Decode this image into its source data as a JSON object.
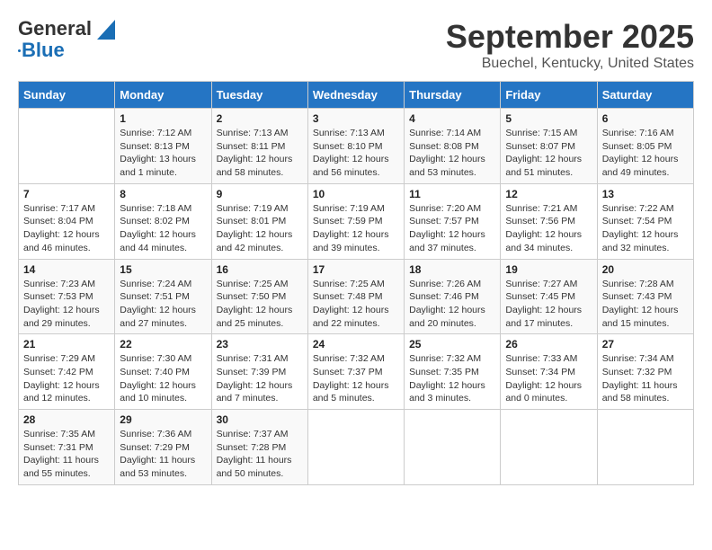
{
  "header": {
    "logo_general": "General",
    "logo_blue": "Blue",
    "title": "September 2025",
    "subtitle": "Buechel, Kentucky, United States"
  },
  "calendar": {
    "days_of_week": [
      "Sunday",
      "Monday",
      "Tuesday",
      "Wednesday",
      "Thursday",
      "Friday",
      "Saturday"
    ],
    "weeks": [
      [
        {
          "day": "",
          "info": ""
        },
        {
          "day": "1",
          "info": "Sunrise: 7:12 AM\nSunset: 8:13 PM\nDaylight: 13 hours\nand 1 minute."
        },
        {
          "day": "2",
          "info": "Sunrise: 7:13 AM\nSunset: 8:11 PM\nDaylight: 12 hours\nand 58 minutes."
        },
        {
          "day": "3",
          "info": "Sunrise: 7:13 AM\nSunset: 8:10 PM\nDaylight: 12 hours\nand 56 minutes."
        },
        {
          "day": "4",
          "info": "Sunrise: 7:14 AM\nSunset: 8:08 PM\nDaylight: 12 hours\nand 53 minutes."
        },
        {
          "day": "5",
          "info": "Sunrise: 7:15 AM\nSunset: 8:07 PM\nDaylight: 12 hours\nand 51 minutes."
        },
        {
          "day": "6",
          "info": "Sunrise: 7:16 AM\nSunset: 8:05 PM\nDaylight: 12 hours\nand 49 minutes."
        }
      ],
      [
        {
          "day": "7",
          "info": "Sunrise: 7:17 AM\nSunset: 8:04 PM\nDaylight: 12 hours\nand 46 minutes."
        },
        {
          "day": "8",
          "info": "Sunrise: 7:18 AM\nSunset: 8:02 PM\nDaylight: 12 hours\nand 44 minutes."
        },
        {
          "day": "9",
          "info": "Sunrise: 7:19 AM\nSunset: 8:01 PM\nDaylight: 12 hours\nand 42 minutes."
        },
        {
          "day": "10",
          "info": "Sunrise: 7:19 AM\nSunset: 7:59 PM\nDaylight: 12 hours\nand 39 minutes."
        },
        {
          "day": "11",
          "info": "Sunrise: 7:20 AM\nSunset: 7:57 PM\nDaylight: 12 hours\nand 37 minutes."
        },
        {
          "day": "12",
          "info": "Sunrise: 7:21 AM\nSunset: 7:56 PM\nDaylight: 12 hours\nand 34 minutes."
        },
        {
          "day": "13",
          "info": "Sunrise: 7:22 AM\nSunset: 7:54 PM\nDaylight: 12 hours\nand 32 minutes."
        }
      ],
      [
        {
          "day": "14",
          "info": "Sunrise: 7:23 AM\nSunset: 7:53 PM\nDaylight: 12 hours\nand 29 minutes."
        },
        {
          "day": "15",
          "info": "Sunrise: 7:24 AM\nSunset: 7:51 PM\nDaylight: 12 hours\nand 27 minutes."
        },
        {
          "day": "16",
          "info": "Sunrise: 7:25 AM\nSunset: 7:50 PM\nDaylight: 12 hours\nand 25 minutes."
        },
        {
          "day": "17",
          "info": "Sunrise: 7:25 AM\nSunset: 7:48 PM\nDaylight: 12 hours\nand 22 minutes."
        },
        {
          "day": "18",
          "info": "Sunrise: 7:26 AM\nSunset: 7:46 PM\nDaylight: 12 hours\nand 20 minutes."
        },
        {
          "day": "19",
          "info": "Sunrise: 7:27 AM\nSunset: 7:45 PM\nDaylight: 12 hours\nand 17 minutes."
        },
        {
          "day": "20",
          "info": "Sunrise: 7:28 AM\nSunset: 7:43 PM\nDaylight: 12 hours\nand 15 minutes."
        }
      ],
      [
        {
          "day": "21",
          "info": "Sunrise: 7:29 AM\nSunset: 7:42 PM\nDaylight: 12 hours\nand 12 minutes."
        },
        {
          "day": "22",
          "info": "Sunrise: 7:30 AM\nSunset: 7:40 PM\nDaylight: 12 hours\nand 10 minutes."
        },
        {
          "day": "23",
          "info": "Sunrise: 7:31 AM\nSunset: 7:39 PM\nDaylight: 12 hours\nand 7 minutes."
        },
        {
          "day": "24",
          "info": "Sunrise: 7:32 AM\nSunset: 7:37 PM\nDaylight: 12 hours\nand 5 minutes."
        },
        {
          "day": "25",
          "info": "Sunrise: 7:32 AM\nSunset: 7:35 PM\nDaylight: 12 hours\nand 3 minutes."
        },
        {
          "day": "26",
          "info": "Sunrise: 7:33 AM\nSunset: 7:34 PM\nDaylight: 12 hours\nand 0 minutes."
        },
        {
          "day": "27",
          "info": "Sunrise: 7:34 AM\nSunset: 7:32 PM\nDaylight: 11 hours\nand 58 minutes."
        }
      ],
      [
        {
          "day": "28",
          "info": "Sunrise: 7:35 AM\nSunset: 7:31 PM\nDaylight: 11 hours\nand 55 minutes."
        },
        {
          "day": "29",
          "info": "Sunrise: 7:36 AM\nSunset: 7:29 PM\nDaylight: 11 hours\nand 53 minutes."
        },
        {
          "day": "30",
          "info": "Sunrise: 7:37 AM\nSunset: 7:28 PM\nDaylight: 11 hours\nand 50 minutes."
        },
        {
          "day": "",
          "info": ""
        },
        {
          "day": "",
          "info": ""
        },
        {
          "day": "",
          "info": ""
        },
        {
          "day": "",
          "info": ""
        }
      ]
    ]
  }
}
